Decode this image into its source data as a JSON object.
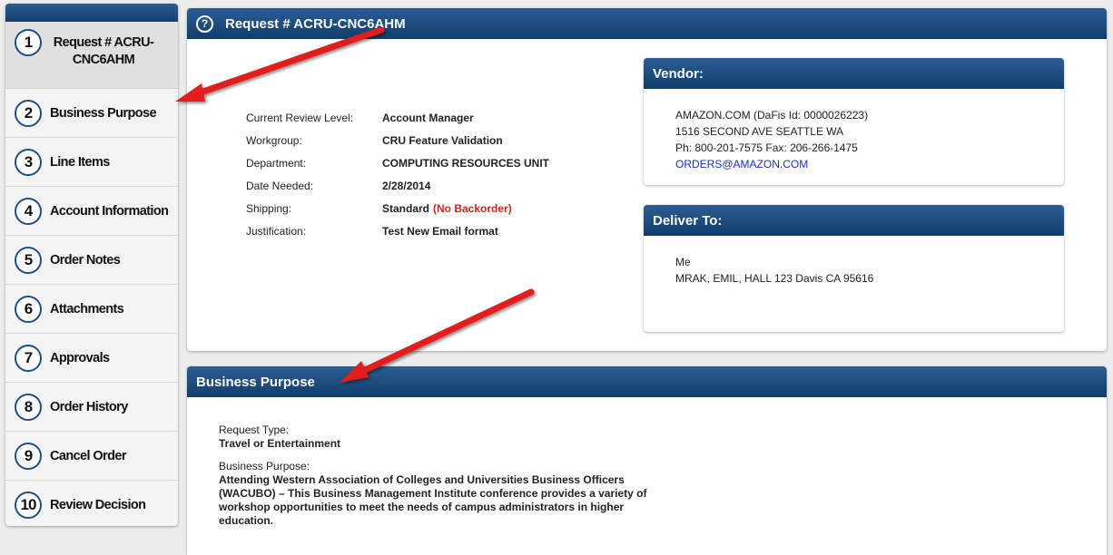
{
  "sidebar": {
    "items": [
      {
        "num": "1",
        "label": "Request # ACRU-CNC6AHM"
      },
      {
        "num": "2",
        "label": "Business Purpose"
      },
      {
        "num": "3",
        "label": "Line Items"
      },
      {
        "num": "4",
        "label": "Account Information"
      },
      {
        "num": "5",
        "label": "Order Notes"
      },
      {
        "num": "6",
        "label": "Attachments"
      },
      {
        "num": "7",
        "label": "Approvals"
      },
      {
        "num": "8",
        "label": "Order History"
      },
      {
        "num": "9",
        "label": "Cancel Order"
      },
      {
        "num": "10",
        "label": "Review Decision"
      }
    ]
  },
  "request": {
    "title": "Request # ACRU-CNC6AHM",
    "help_glyph": "?",
    "details": [
      {
        "label": "Current Review Level:",
        "value": "Account Manager"
      },
      {
        "label": "Workgroup:",
        "value": "CRU Feature Validation"
      },
      {
        "label": "Department:",
        "value": "COMPUTING RESOURCES UNIT"
      },
      {
        "label": "Date Needed:",
        "value": "2/28/2014"
      },
      {
        "label": "Shipping:",
        "value": "Standard",
        "note": "(No Backorder)"
      },
      {
        "label": "Justification:",
        "value": "Test New Email format"
      }
    ]
  },
  "vendor": {
    "title": "Vendor:",
    "lines": [
      "AMAZON.COM (DaFis Id: 0000026223)",
      "1516 SECOND AVE SEATTLE WA",
      "Ph: 800-201-7575 Fax: 206-266-1475"
    ],
    "email": "ORDERS@AMAZON.COM"
  },
  "deliver": {
    "title": "Deliver To:",
    "lines": [
      "Me",
      "MRAK, EMIL, HALL 123 Davis CA 95616"
    ]
  },
  "business_purpose": {
    "title": "Business Purpose",
    "request_type_label": "Request Type:",
    "request_type_value": "Travel or Entertainment",
    "purpose_label": "Business Purpose:",
    "purpose_lines": [
      "Attending Western Association of Colleges and Universities Business Officers",
      "(WACUBO) – This Business Management Institute conference provides a variety of",
      "workshop opportunities to meet the needs of campus administrators in higher",
      "education."
    ]
  },
  "colors": {
    "header_blue": "#14406f",
    "warning_red": "#d0261d",
    "link_blue": "#1b2fc4",
    "arrow_red": "#e31b1b"
  }
}
